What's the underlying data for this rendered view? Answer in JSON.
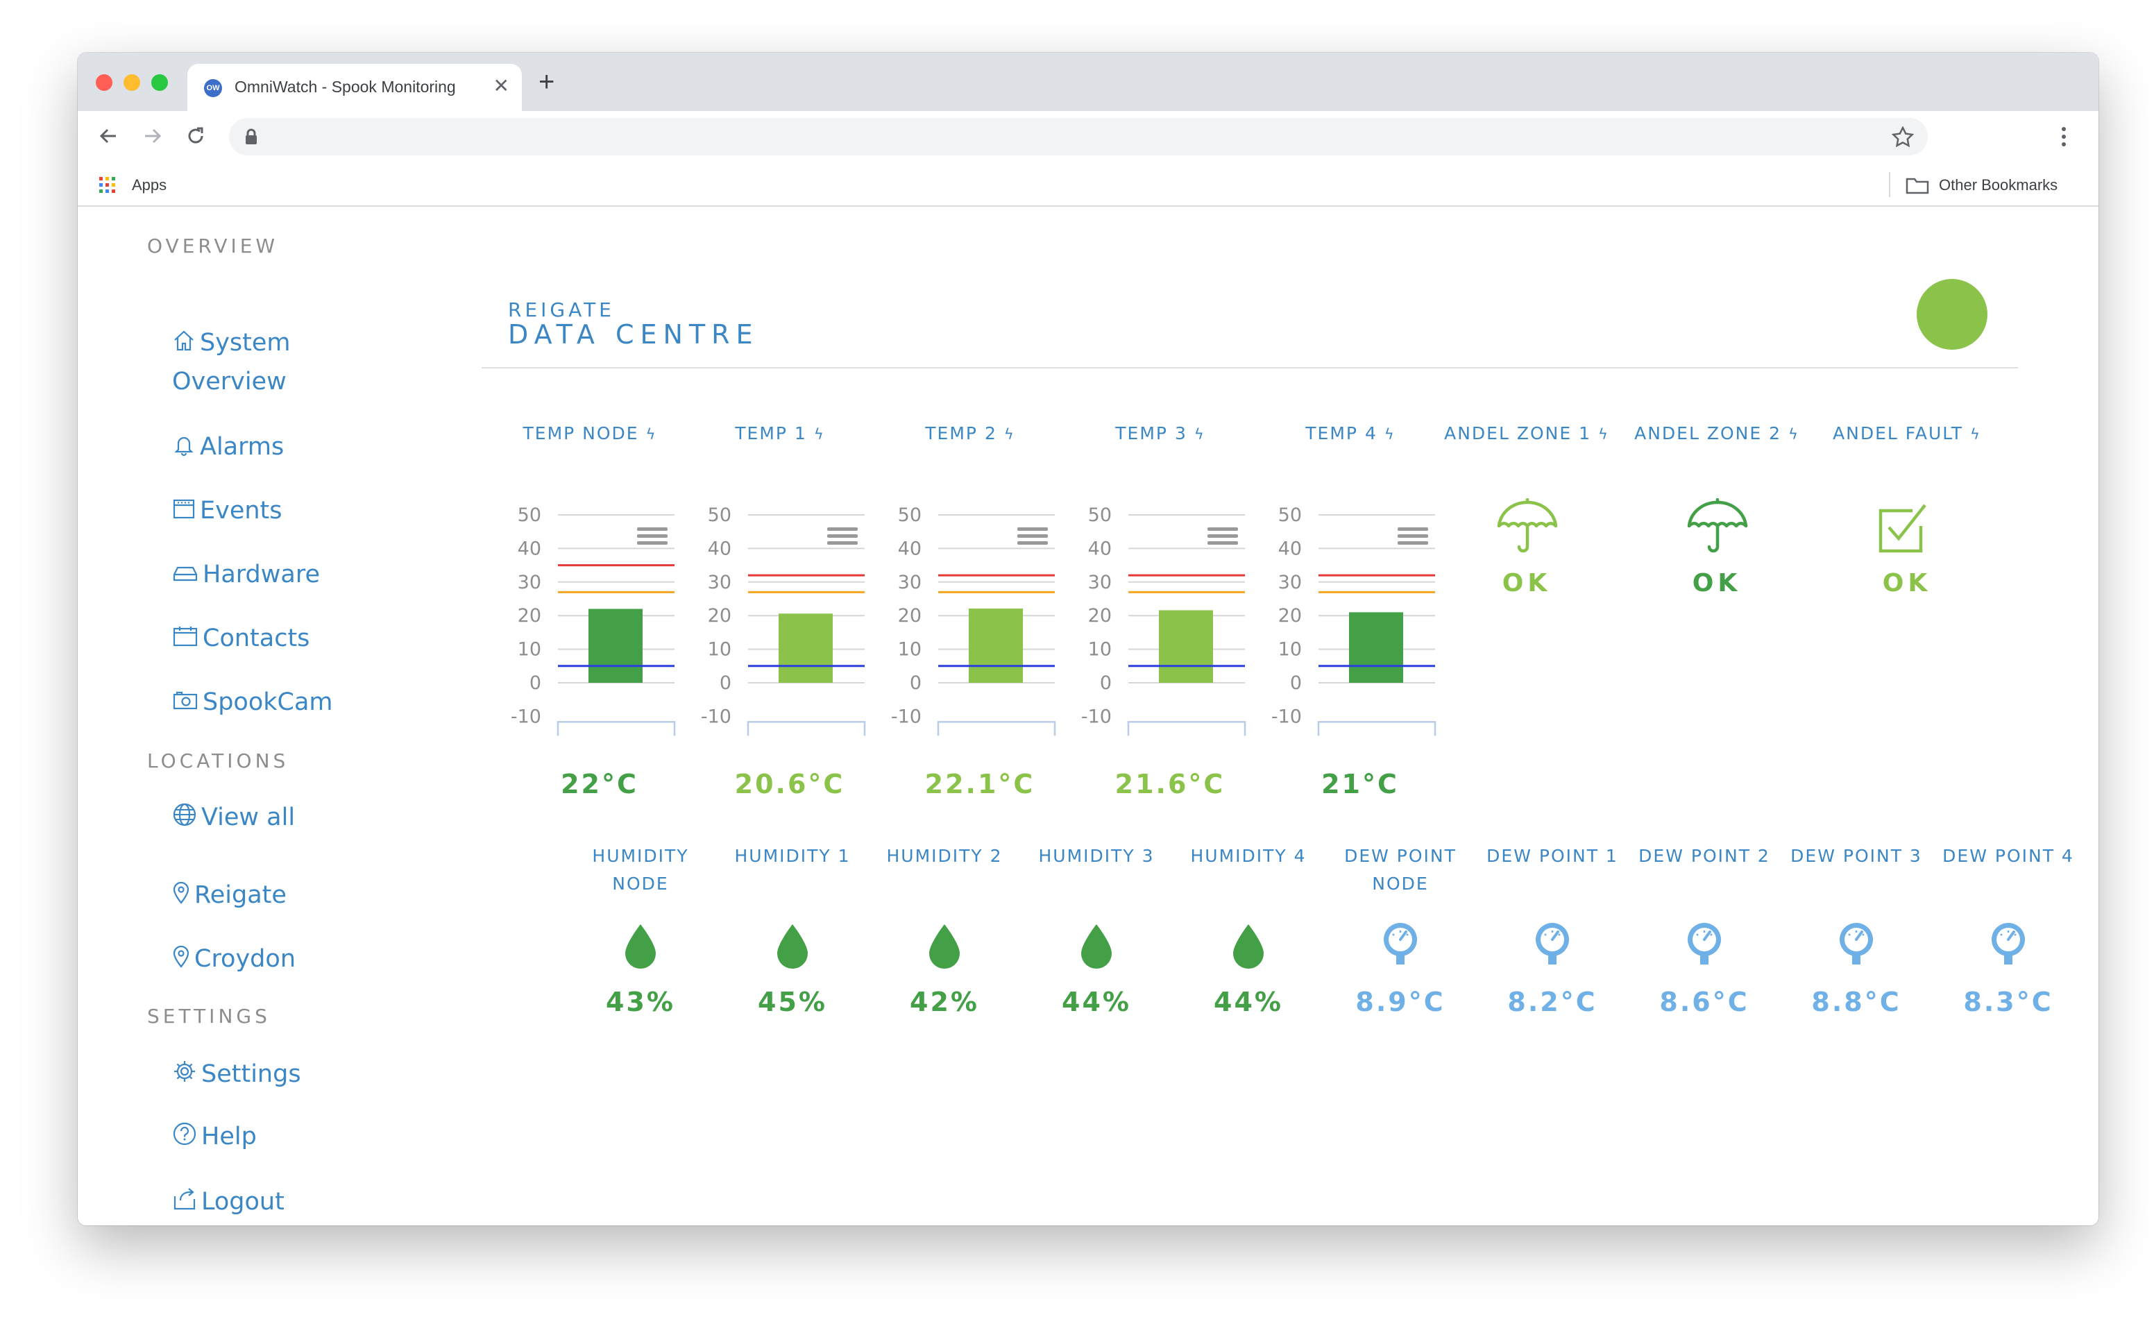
{
  "browser": {
    "tab_title": "OmniWatch - Spook Monitoring",
    "favicon_text": "OW",
    "close_glyph": "✕",
    "new_tab_glyph": "+",
    "apps_label": "Apps",
    "other_bookmarks_label": "Other Bookmarks"
  },
  "sidebar": {
    "overview_header": "OVERVIEW",
    "overview_items": [
      {
        "label": "System Overview",
        "icon": "home-icon"
      },
      {
        "label": "Alarms",
        "icon": "bell-icon"
      },
      {
        "label": "Events",
        "icon": "calendar-icon"
      },
      {
        "label": "Hardware",
        "icon": "hard-drive-icon"
      },
      {
        "label": "Contacts",
        "icon": "contacts-icon"
      },
      {
        "label": "SpookCam",
        "icon": "camera-icon"
      }
    ],
    "locations_header": "LOCATIONS",
    "location_items": [
      {
        "label": "View all",
        "icon": "globe-icon"
      },
      {
        "label": "Reigate",
        "icon": "map-pin-icon"
      },
      {
        "label": "Croydon",
        "icon": "map-pin-icon"
      }
    ],
    "settings_header": "SETTINGS",
    "settings_items": [
      {
        "label": "Settings",
        "icon": "gear-icon"
      },
      {
        "label": "Help",
        "icon": "help-icon"
      },
      {
        "label": "Logout",
        "icon": "logout-icon"
      }
    ]
  },
  "header": {
    "location": "REIGATE",
    "title": "DATA CENTRE",
    "status_color": "#8bc34a"
  },
  "colors": {
    "accent": "#3b86c4",
    "dark_green": "#43a047",
    "light_green": "#8bc34a",
    "light_blue": "#6fb0e6",
    "high_threshold": "#e53935",
    "warn_threshold": "#f5a623",
    "low_threshold": "#2a3fdc"
  },
  "temperatures": [
    {
      "label": "TEMP NODE",
      "value_text": "22°C",
      "value": 22,
      "color": "#43a047"
    },
    {
      "label": "TEMP 1",
      "value_text": "20.6°C",
      "value": 20.6,
      "color": "#8bc34a"
    },
    {
      "label": "TEMP 2",
      "value_text": "22.1°C",
      "value": 22.1,
      "color": "#8bc34a"
    },
    {
      "label": "TEMP 3",
      "value_text": "21.6°C",
      "value": 21.6,
      "color": "#8bc34a"
    },
    {
      "label": "TEMP 4",
      "value_text": "21°C",
      "value": 21,
      "color": "#43a047"
    }
  ],
  "gauge_scale": {
    "ticks": [
      "50",
      "40",
      "30",
      "20",
      "10",
      "0",
      "-10"
    ],
    "min": -10,
    "max": 50,
    "high_threshold": 35,
    "high_threshold_tight": 32,
    "warn_threshold": 27,
    "low_threshold": 5
  },
  "zones": [
    {
      "label": "ANDEL ZONE 1",
      "status": "OK",
      "icon": "umbrella-icon",
      "color": "#8bc34a"
    },
    {
      "label": "ANDEL ZONE 2",
      "status": "OK",
      "icon": "umbrella-icon",
      "color": "#43a047"
    },
    {
      "label": "ANDEL FAULT",
      "status": "OK",
      "icon": "checkbox-icon",
      "color": "#8bc34a"
    }
  ],
  "humidity": [
    {
      "label_line1": "HUMIDITY",
      "label_line2": "NODE",
      "value": "43%"
    },
    {
      "label_line1": "HUMIDITY 1",
      "label_line2": "",
      "value": "45%"
    },
    {
      "label_line1": "HUMIDITY 2",
      "label_line2": "",
      "value": "42%"
    },
    {
      "label_line1": "HUMIDITY 3",
      "label_line2": "",
      "value": "44%"
    },
    {
      "label_line1": "HUMIDITY 4",
      "label_line2": "",
      "value": "44%"
    }
  ],
  "dew_points": [
    {
      "label_line1": "DEW POINT",
      "label_line2": "NODE",
      "value": "8.9°C"
    },
    {
      "label_line1": "DEW POINT 1",
      "label_line2": "",
      "value": "8.2°C"
    },
    {
      "label_line1": "DEW POINT 2",
      "label_line2": "",
      "value": "8.6°C"
    },
    {
      "label_line1": "DEW POINT 3",
      "label_line2": "",
      "value": "8.8°C"
    },
    {
      "label_line1": "DEW POINT 4",
      "label_line2": "",
      "value": "8.3°C"
    }
  ]
}
